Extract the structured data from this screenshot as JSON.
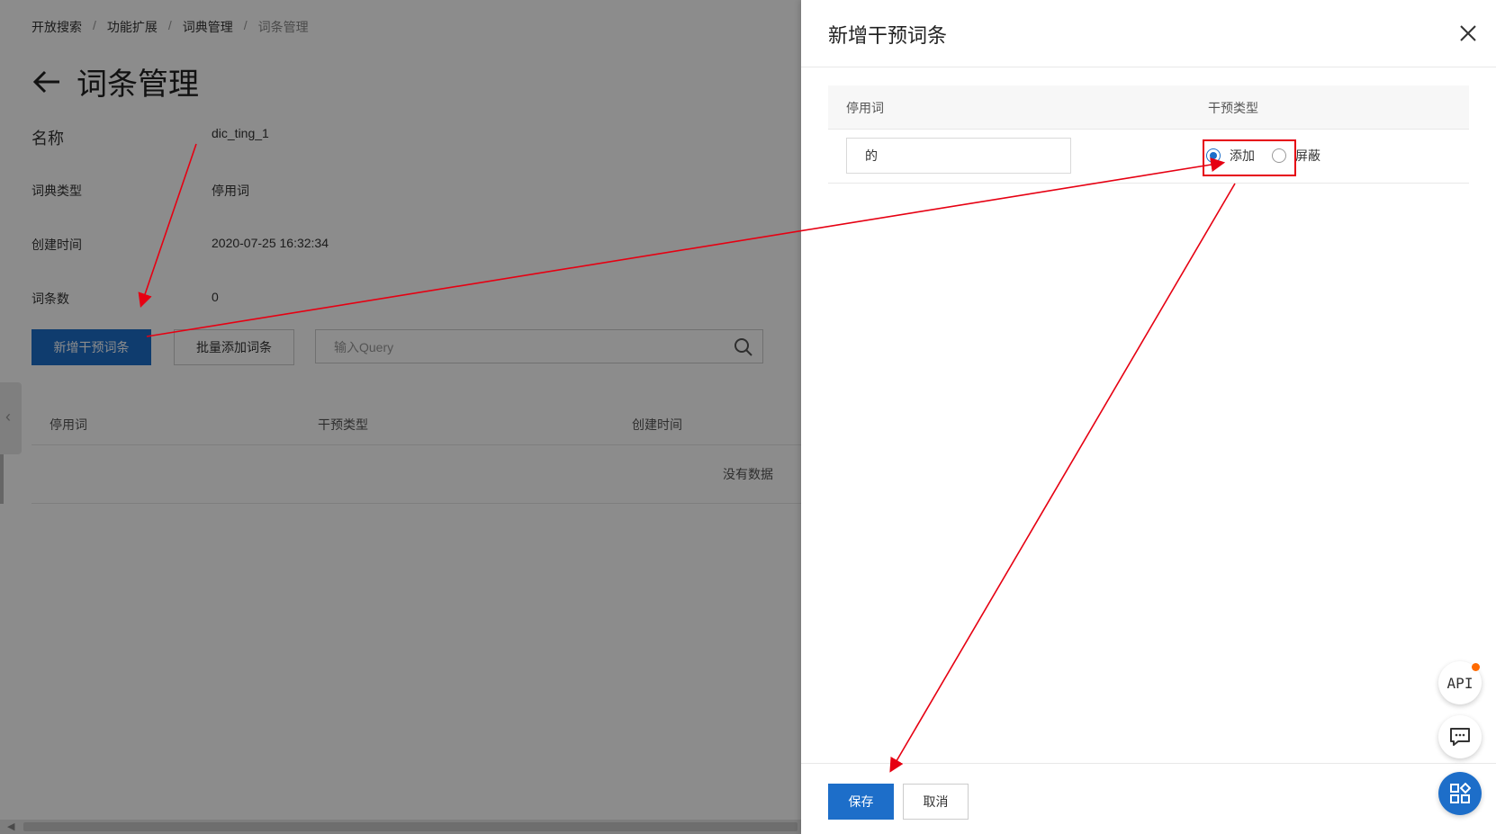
{
  "breadcrumb": [
    "开放搜索",
    "功能扩展",
    "词典管理",
    "词条管理"
  ],
  "page_title": "词条管理",
  "info": {
    "name_label": "名称",
    "name_value": "dic_ting_1",
    "type_label": "词典类型",
    "type_value": "停用词",
    "created_label": "创建时间",
    "created_value": "2020-07-25 16:32:34",
    "count_label": "词条数",
    "count_value": "0"
  },
  "toolbar": {
    "add_label": "新增干预词条",
    "batch_label": "批量添加词条",
    "search_placeholder": "输入Query"
  },
  "table": {
    "columns": [
      "停用词",
      "干预类型",
      "创建时间"
    ],
    "empty_text": "没有数据"
  },
  "drawer": {
    "title": "新增干预词条",
    "columns": [
      "停用词",
      "干预类型"
    ],
    "word_value": "的",
    "radio_add": "添加",
    "radio_block": "屏蔽",
    "selected": "添加",
    "save_label": "保存",
    "cancel_label": "取消"
  },
  "floating": {
    "api_label": "API"
  },
  "colors": {
    "primary": "#1d6ec9",
    "annotation": "#e60012",
    "badge": "#ff6a00"
  }
}
